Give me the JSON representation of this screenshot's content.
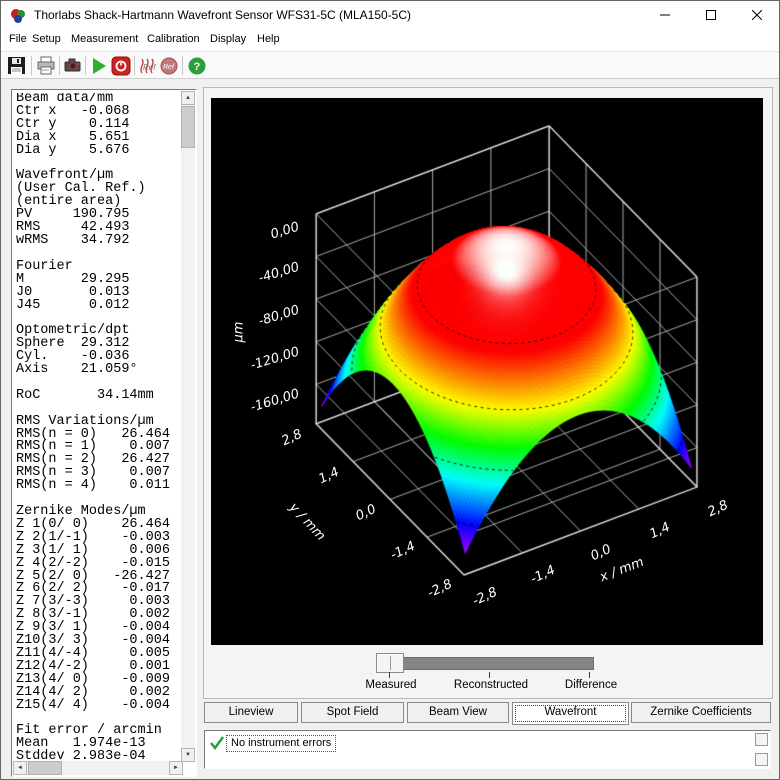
{
  "window": {
    "title": "Thorlabs Shack-Hartmann Wavefront Sensor WFS31-5C (MLA150-5C)"
  },
  "menu": {
    "items": [
      "File",
      "Setup",
      "Measurement",
      "Calibration",
      "Display",
      "Help"
    ]
  },
  "toolbar": {
    "icons": [
      "save",
      "print",
      "camera",
      "start-measurement",
      "stop-measurement",
      "reference-flat",
      "reference-user",
      "help"
    ]
  },
  "left_panel": {
    "lines": [
      "Beam data/mm",
      "Ctr x   -0.068",
      "Ctr y    0.114",
      "Dia x    5.651",
      "Dia y    5.676",
      "",
      "Wavefront/µm",
      "(User Cal. Ref.)",
      "(entire area)",
      "PV     190.795",
      "RMS     42.493",
      "wRMS    34.792",
      "",
      "Fourier",
      "M       29.295",
      "J0       0.013",
      "J45      0.012",
      "",
      "Optometric/dpt",
      "Sphere  29.312",
      "Cyl.    -0.036",
      "Axis    21.059°",
      "",
      "RoC       34.14mm",
      "",
      "RMS Variations/µm",
      "RMS(n = 0)   26.464",
      "RMS(n = 1)    0.007",
      "RMS(n = 2)   26.427",
      "RMS(n = 3)    0.007",
      "RMS(n = 4)    0.011",
      "",
      "Zernike Modes/µm",
      "Z 1(0/ 0)    26.464",
      "Z 2(1/-1)    -0.003",
      "Z 3(1/ 1)     0.006",
      "Z 4(2/-2)    -0.015",
      "Z 5(2/ 0)   -26.427",
      "Z 6(2/ 2)    -0.017",
      "Z 7(3/-3)     0.003",
      "Z 8(3/-1)     0.002",
      "Z 9(3/ 1)    -0.004",
      "Z10(3/ 3)    -0.004",
      "Z11(4/-4)     0.005",
      "Z12(4/-2)     0.001",
      "Z13(4/ 0)    -0.009",
      "Z14(4/ 2)     0.002",
      "Z15(4/ 4)    -0.004",
      "",
      "Fit error / arcmin",
      "Mean   1.974e-13",
      "Stddev 2.983e-04"
    ]
  },
  "slider": {
    "labels": [
      "Measured",
      "Reconstructed",
      "Difference"
    ],
    "value": "Measured"
  },
  "tabs": {
    "items": [
      {
        "label": "Lineview",
        "selected": false
      },
      {
        "label": "Spot Field",
        "selected": false
      },
      {
        "label": "Beam View",
        "selected": false
      },
      {
        "label": "Wavefront",
        "selected": true
      },
      {
        "label": "Zernike Coefficients",
        "selected": false
      }
    ]
  },
  "status": {
    "message": "No instrument errors",
    "ok": true,
    "check_color": "#1d9f3c"
  },
  "chart_data": {
    "type": "surface3d",
    "x_label": "x / mm",
    "y_label": "y / mm",
    "z_label": "µm",
    "x_ticks": {
      "values": [
        -2.8,
        -1.4,
        0,
        1.4,
        2.8
      ],
      "labels": [
        "-2,8",
        "-1,4",
        "0,0",
        "1,4",
        "2,8"
      ]
    },
    "y_ticks": {
      "values": [
        2.8,
        1.4,
        0,
        -1.4,
        -2.8
      ],
      "labels": [
        "2,8",
        "1,4",
        "0,0",
        "-1,4",
        "-2,8"
      ]
    },
    "z_ticks": {
      "values": [
        0,
        -40,
        -80,
        -120,
        -160
      ],
      "labels": [
        "0,00",
        "-40,00",
        "-80,00",
        "-120,00",
        "-160,00"
      ]
    },
    "x_range": [
      -2.8,
      2.8
    ],
    "y_range": [
      -2.8,
      2.8
    ],
    "z_range": [
      -197,
      0
    ],
    "surface": {
      "model": "defocus-paraboloid",
      "pv_um": 190.795,
      "domain": [
        -2.72,
        2.72
      ],
      "contour_levels_um": [
        -40,
        -80,
        -120,
        -160
      ]
    },
    "colormap": [
      "#ffffff",
      "#ff0000",
      "#ff8000",
      "#ffff00",
      "#00ff00",
      "#00ffff",
      "#0000ff",
      "#ff00ff"
    ],
    "background": "#000000"
  }
}
